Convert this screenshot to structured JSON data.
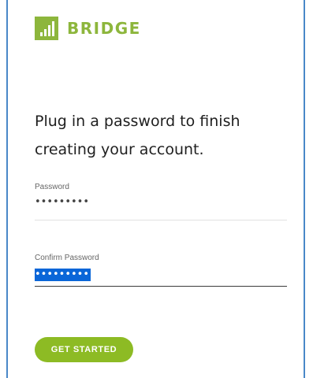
{
  "brand": {
    "name": "BRIDGE",
    "logo_icon": "signal-bars-icon",
    "color": "#8db63c"
  },
  "heading": "Plug in a password to finish creating your account.",
  "password_field": {
    "label": "Password",
    "masked_value": "•••••••••"
  },
  "confirm_field": {
    "label": "Confirm Password",
    "masked_value": "•••••••••",
    "selected": true
  },
  "button": {
    "label": "GET STARTED",
    "color": "#8dbb24"
  },
  "colors": {
    "selection": "#0a66d8",
    "frame_border": "#4a88c8"
  }
}
